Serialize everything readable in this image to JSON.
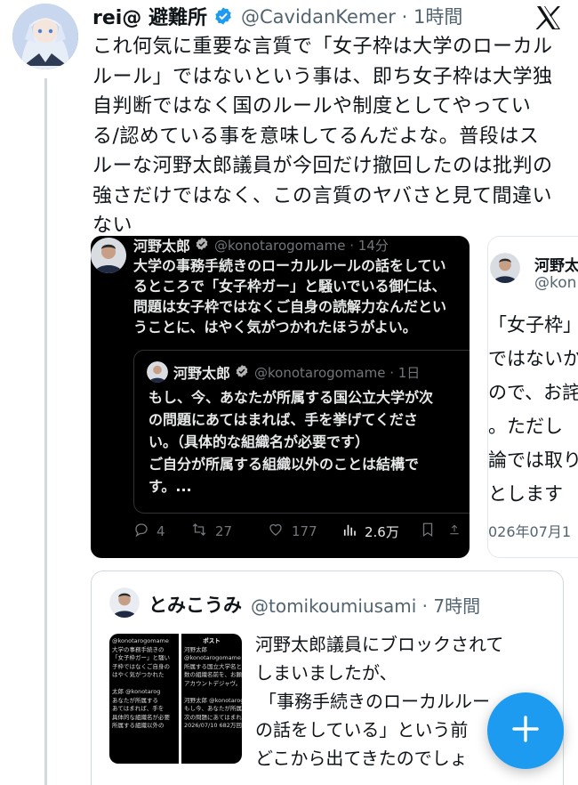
{
  "tweet": {
    "display_name": "rei@ 避難所",
    "handle_time": "@CavidanKemer · 1時間",
    "text_lines": [
      "これ何気に重要な言質で「女子枠は大学のローカル",
      "ルール」ではないという事は、即ち女子枠は大学独",
      "自判断ではなく国のルールや制度としてやってい",
      "る/認めている事を意味してるんだよな。普段はス",
      "ルーな河野太郎議員が今回だけ撤回したのは批判の",
      "強さだけではなく、この言質のヤバさと見て間違い",
      "ない"
    ]
  },
  "embed1": {
    "display_name": "河野太郎",
    "handle_time": "@konotarogomame · 14分",
    "text_lines": [
      "大学の事務手続きのローカルルールの話をしてい",
      "るところで「女子枠ガー」と騒いでいる御仁は、",
      "問題は女子枠ではなくご自身の読解力なんだとい",
      "うことに、はやく気がつかれたほうがよい。"
    ],
    "quote": {
      "display_name": "河野太郎",
      "handle_time": "@konotarogomame · 1日",
      "text_lines": [
        "もし、今、あなたが所属する国公立大学が次",
        "の問題にあてはまれば、手を挙げてくださ",
        "い。（具体的な組織名が必要です）",
        "ご自分が所属する組織以外のことは結構で",
        "す。..."
      ]
    },
    "stats": {
      "replies": "4",
      "retweets": "27",
      "likes": "177",
      "views": "2.6万"
    }
  },
  "embed2": {
    "display_name": "河野太",
    "handle": "@kon",
    "text_lines": [
      "「女子枠」",
      "ではないか",
      "ので、お詫",
      "。ただし",
      "論では取り",
      "とします"
    ],
    "date": "026年07月1"
  },
  "quoted_tweet": {
    "display_name": "とみこうみ",
    "handle_time": "@tomikoumiusami · 7時間",
    "text_lines": [
      "河野太郎議員にブロックされて",
      "しまいましたが、",
      "「事務手続きのローカルルー",
      "の話をしている」という前",
      "どこから出てきたのでしょ"
    ],
    "thumb_left_lines": [
      "@konotarogomame",
      "大学の事務手続きの",
      "「女子枠ガー」と騒い",
      "子枠ではなくご自身の",
      "はやく気がつかれた",
      "",
      "太郎  @konotarog",
      "あなたが所属する",
      "あてはまれば、手を",
      "具体的な組織名が必要",
      "所属する組織以外の"
    ],
    "thumb_right_title": "ポスト",
    "thumb_right_lines": [
      "河野太郎",
      "@konotarogomame",
      "所属する国立大学名と廃止すべき",
      "数の組織名前を、お願いします。",
      "アカウントデジャヴ。",
      "",
      "河野太郎 @konotarogomame · 2",
      "もし今、あなたが所属する国",
      "次の問題にあてはまれば…",
      "2026/07/10   682万回表示"
    ]
  },
  "icons": {
    "logo": "x-logo-icon",
    "compose": "plus-icon"
  },
  "colors": {
    "accent": "#1d9bf0",
    "verified": "#1d9bf0",
    "dark_card": "#000000"
  }
}
